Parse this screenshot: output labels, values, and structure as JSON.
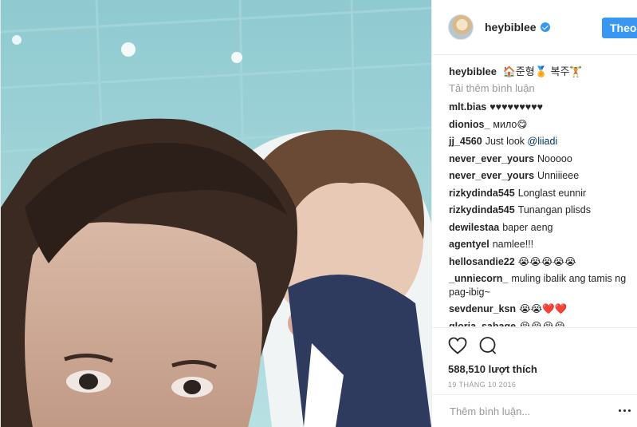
{
  "post": {
    "username": "heybiblee",
    "follow_label": "Theo dõi",
    "caption_text": "🏠준형🏅 복주🏋",
    "load_more": "Tải thêm bình luận",
    "likes": "588,510 lượt thích",
    "date": "19 THÁNG 10 2016",
    "comment_placeholder": "Thêm bình luận...",
    "colors": {
      "accent": "#3897f0",
      "verified": "#3897f0"
    }
  },
  "comments": [
    {
      "user": "mlt.bias",
      "text": "♥♥♥♥♥♥♥♥♥"
    },
    {
      "user": "dionios_",
      "text": "мило😋"
    },
    {
      "user": "jj_4560",
      "text": "Just look ",
      "mention": "@liiadi"
    },
    {
      "user": "never_ever_yours",
      "text": "Nooooo"
    },
    {
      "user": "never_ever_yours",
      "text": "Unniiieee"
    },
    {
      "user": "rizkydinda545",
      "text": "Longlast eunnir"
    },
    {
      "user": "rizkydinda545",
      "text": "Tunangan plisds"
    },
    {
      "user": "dewilestaa",
      "text": "baper aeng"
    },
    {
      "user": "agentyel",
      "text": "namlee!!!"
    },
    {
      "user": "hellosandie22",
      "text": "😭😭😭😭😭"
    },
    {
      "user": "_unniecorn_",
      "text": "muling ibalik ang tamis ng pag-ibig~"
    },
    {
      "user": "sevdenur_ksn",
      "text": "😭😭❤️❤️"
    },
    {
      "user": "gloria_sabage",
      "text": "😭😭😭😭"
    }
  ],
  "icons": {
    "like": "heart-icon",
    "comment": "comment-bubble-icon",
    "verified": "verified-badge-icon",
    "more": "more-options-icon"
  }
}
